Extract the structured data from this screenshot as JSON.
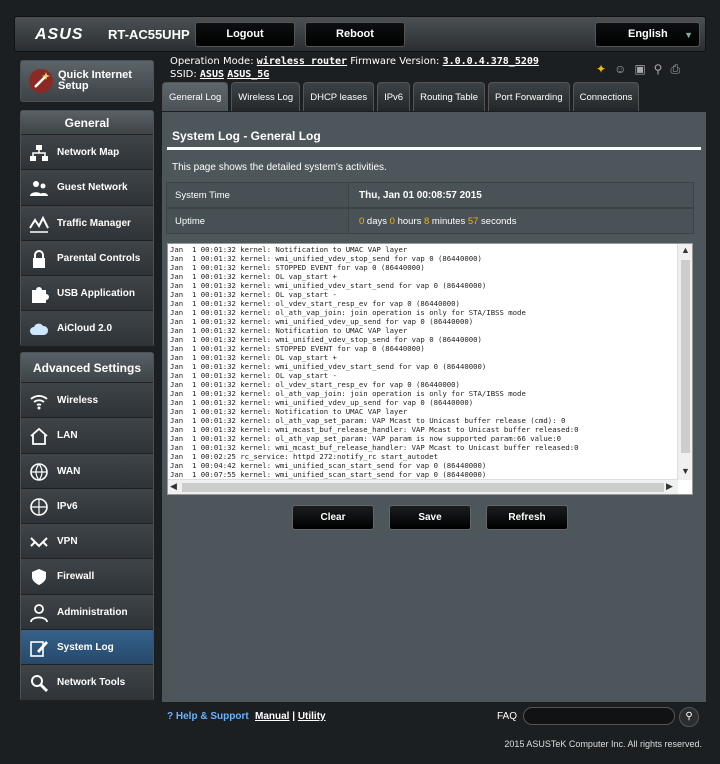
{
  "header": {
    "brand": "ASUS",
    "model": "RT-AC55UHP",
    "logout_label": "Logout",
    "reboot_label": "Reboot",
    "language": "English"
  },
  "info": {
    "op_mode_label": "Operation Mode:",
    "op_mode_value": "wireless router",
    "firmware_label": "Firmware Version:",
    "firmware_value": "3.0.0.4.378_5209",
    "ssid_label": "SSID:",
    "ssid_1": "ASUS",
    "ssid_2": "ASUS_5G"
  },
  "sidebar": {
    "quick_setup": "Quick Internet Setup",
    "general_title": "General",
    "general_items": [
      {
        "label": "Network Map"
      },
      {
        "label": "Guest Network"
      },
      {
        "label": "Traffic Manager"
      },
      {
        "label": "Parental Controls"
      },
      {
        "label": "USB Application"
      },
      {
        "label": "AiCloud 2.0"
      }
    ],
    "advanced_title": "Advanced Settings",
    "advanced_items": [
      {
        "label": "Wireless"
      },
      {
        "label": "LAN"
      },
      {
        "label": "WAN"
      },
      {
        "label": "IPv6"
      },
      {
        "label": "VPN"
      },
      {
        "label": "Firewall"
      },
      {
        "label": "Administration"
      },
      {
        "label": "System Log"
      },
      {
        "label": "Network Tools"
      }
    ]
  },
  "tabs": [
    {
      "label": "General Log"
    },
    {
      "label": "Wireless Log"
    },
    {
      "label": "DHCP leases"
    },
    {
      "label": "IPv6"
    },
    {
      "label": "Routing Table"
    },
    {
      "label": "Port Forwarding"
    },
    {
      "label": "Connections"
    }
  ],
  "main": {
    "title": "System Log - General Log",
    "description": "This page shows the detailed system's activities.",
    "system_time_label": "System Time",
    "system_time_value": "Thu, Jan 01 00:08:57 2015",
    "uptime_label": "Uptime",
    "uptime_days": "0",
    "uptime_days_unit": " days ",
    "uptime_hours": "0",
    "uptime_hours_unit": " hours ",
    "uptime_minutes": "8",
    "uptime_minutes_unit": " minutes ",
    "uptime_seconds": "57",
    "uptime_seconds_unit": " seconds",
    "log_lines": [
      "Jan  1 00:01:32 kernel: Notification to UMAC VAP layer",
      "Jan  1 00:01:32 kernel: wmi_unified_vdev_stop_send for vap 0 (86440000)",
      "Jan  1 00:01:32 kernel: STOPPED EVENT for vap 0 (86440000)",
      "Jan  1 00:01:32 kernel: OL vap_start +",
      "Jan  1 00:01:32 kernel: wmi_unified_vdev_start_send for vap 0 (86440000)",
      "Jan  1 00:01:32 kernel: OL vap_start -",
      "Jan  1 00:01:32 kernel: ol_vdev_start_resp_ev for vap 0 (86440000)",
      "Jan  1 00:01:32 kernel: ol_ath_vap_join: join operation is only for STA/IBSS mode",
      "Jan  1 00:01:32 kernel: wmi_unified_vdev_up_send for vap 0 (86440000)",
      "Jan  1 00:01:32 kernel: Notification to UMAC VAP layer",
      "Jan  1 00:01:32 kernel: wmi_unified_vdev_stop_send for vap 0 (86440000)",
      "Jan  1 00:01:32 kernel: STOPPED EVENT for vap 0 (86440000)",
      "Jan  1 00:01:32 kernel: OL vap_start +",
      "Jan  1 00:01:32 kernel: wmi_unified_vdev_start_send for vap 0 (86440000)",
      "Jan  1 00:01:32 kernel: OL vap_start -",
      "Jan  1 00:01:32 kernel: ol_vdev_start_resp_ev for vap 0 (86440000)",
      "Jan  1 00:01:32 kernel: ol_ath_vap_join: join operation is only for STA/IBSS mode",
      "Jan  1 00:01:32 kernel: wmi_unified_vdev_up_send for vap 0 (86440000)",
      "Jan  1 00:01:32 kernel: Notification to UMAC VAP layer",
      "Jan  1 00:01:32 kernel: ol_ath_vap_set_param: VAP Mcast to Unicast buffer release (cmd): 0",
      "Jan  1 00:01:32 kernel: wmi_mcast_buf_release_handler: VAP Mcast to Unicast buffer released:0",
      "Jan  1 00:01:32 kernel: ol_ath_vap_set_param: VAP param is now supported param:66 value:0",
      "Jan  1 00:01:32 kernel: wmi_mcast_buf_release_handler: VAP Mcast to Unicast buffer released:0",
      "Jan  1 00:02:25 rc_service: httpd 272:notify_rc start_autodet",
      "Jan  1 00:04:42 kernel: wmi_unified_scan_start_send for vap 0 (86440000)",
      "Jan  1 00:07:55 kernel: wmi_unified_scan_start_send for vap 0 (86440000)"
    ],
    "clear_label": "Clear",
    "save_label": "Save",
    "refresh_label": "Refresh"
  },
  "footer": {
    "help": "Help & Support",
    "manual": "Manual",
    "separator": "|",
    "utility": "Utility",
    "faq": "FAQ",
    "copyright": "2015 ASUSTeK Computer Inc. All rights reserved."
  },
  "colors": {
    "highlight": "#f4b400",
    "active_item": "#35618b",
    "help_link": "#69b3ff"
  }
}
